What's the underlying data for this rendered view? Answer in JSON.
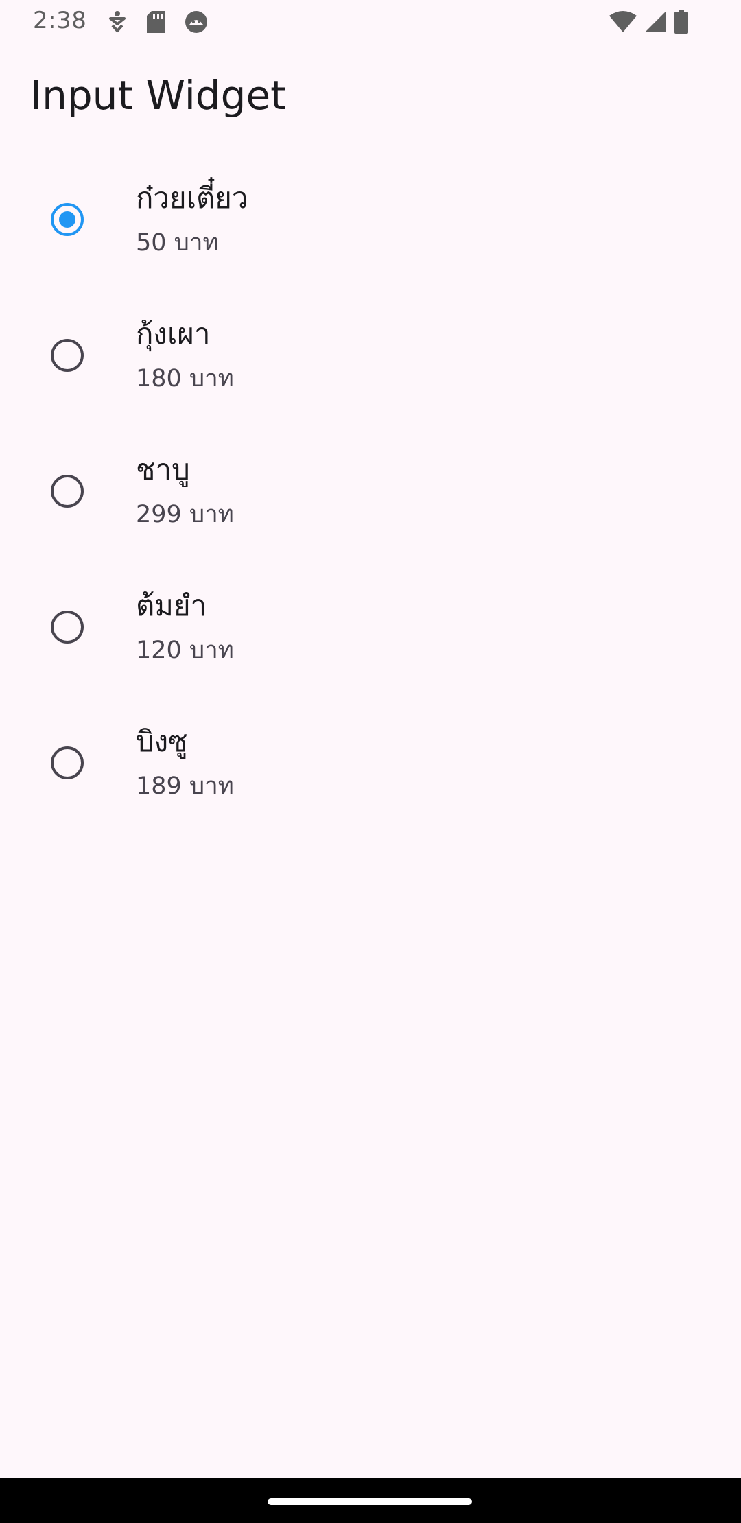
{
  "status_bar": {
    "time": "2:38",
    "left_icons": [
      "accessibility-icon",
      "sd-card-icon",
      "android-debug-icon"
    ],
    "right_icons": [
      "wifi-icon",
      "cell-signal-icon",
      "battery-icon"
    ]
  },
  "app_bar": {
    "title": "Input Widget"
  },
  "menu": {
    "selected_index": 0,
    "items": [
      {
        "name": "ก๋วยเตี๋ยว",
        "price": "50 บาท"
      },
      {
        "name": "กุ้งเผา",
        "price": "180 บาท"
      },
      {
        "name": "ชาบู",
        "price": "299 บาท"
      },
      {
        "name": "ต้มยำ",
        "price": "120 บาท"
      },
      {
        "name": "บิงซู",
        "price": "189 บาท"
      }
    ]
  },
  "colors": {
    "accent": "#2196f3",
    "background": "#fef7fb",
    "unselected_radio": "#49454f"
  }
}
